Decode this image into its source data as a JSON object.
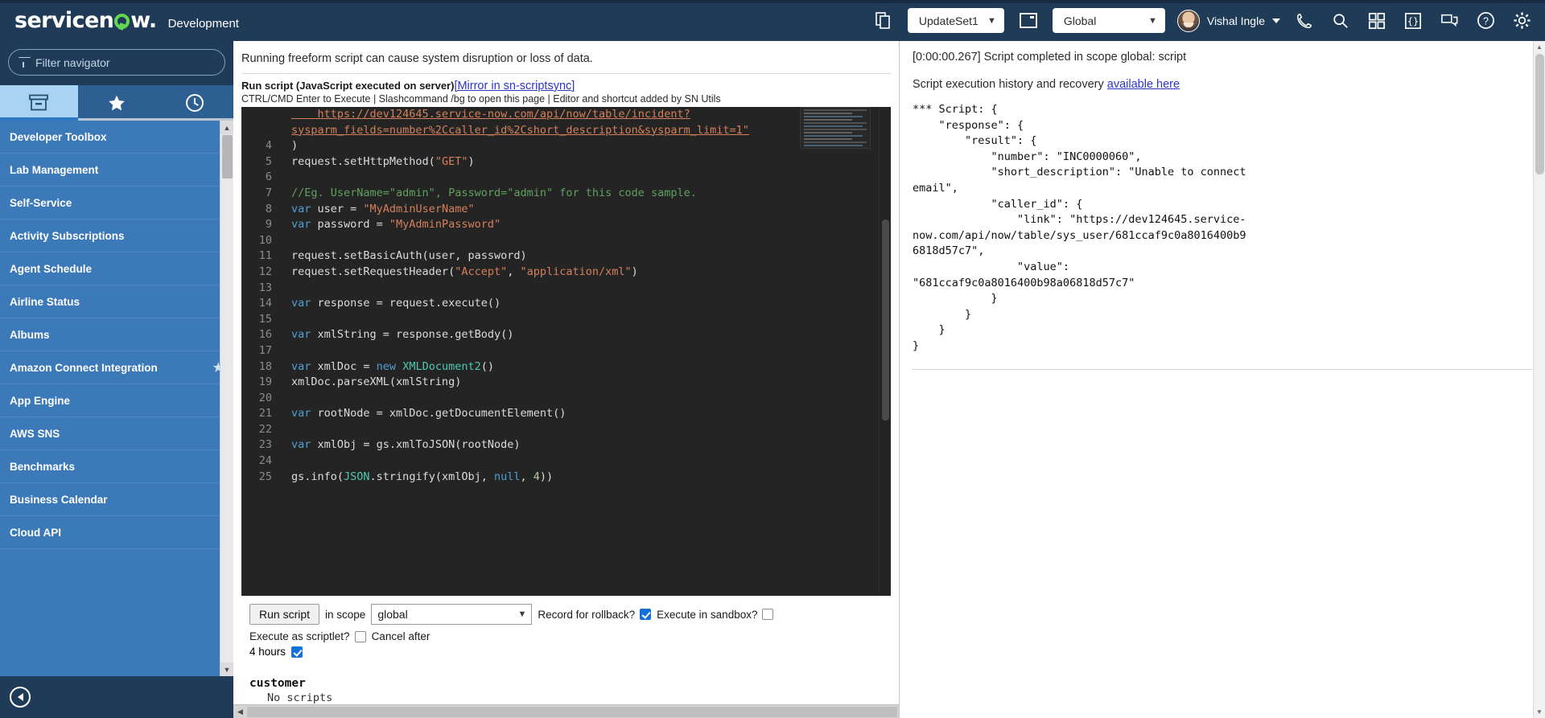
{
  "banner": {
    "logo_text": "servicenow",
    "instance_label": "Development",
    "update_set": "UpdateSet1",
    "application_scope": "Global",
    "user_name": "Vishal Ingle",
    "icons": [
      {
        "name": "copy-update-set-icon",
        "glyph": "❐"
      },
      {
        "name": "window-icon",
        "glyph": "▣"
      },
      {
        "name": "phone-icon",
        "glyph": "☎"
      },
      {
        "name": "search-icon",
        "glyph": "⌕"
      },
      {
        "name": "app-grid-icon",
        "glyph": "☷"
      },
      {
        "name": "code-braces-icon",
        "glyph": "{ }"
      },
      {
        "name": "conversation-icon",
        "glyph": "⧉"
      },
      {
        "name": "help-icon",
        "glyph": "?"
      },
      {
        "name": "gear-icon",
        "glyph": "⚙"
      }
    ]
  },
  "sidebar": {
    "filter_placeholder": "Filter navigator",
    "tabs": [
      {
        "name": "all-applications-tab",
        "icon": "archive-box-icon",
        "active": true
      },
      {
        "name": "favorites-tab",
        "icon": "star-icon",
        "active": false
      },
      {
        "name": "history-tab",
        "icon": "clock-icon",
        "active": false
      }
    ],
    "items": [
      {
        "label": "Developer Toolbox",
        "starred": false
      },
      {
        "label": "Lab Management",
        "starred": false
      },
      {
        "label": "Self-Service",
        "starred": false
      },
      {
        "label": "Activity Subscriptions",
        "starred": false
      },
      {
        "label": "Agent Schedule",
        "starred": false
      },
      {
        "label": "Airline Status",
        "starred": false
      },
      {
        "label": "Albums",
        "starred": false
      },
      {
        "label": "Amazon Connect Integration",
        "starred": true
      },
      {
        "label": "App Engine",
        "starred": false
      },
      {
        "label": "AWS SNS",
        "starred": false
      },
      {
        "label": "Benchmarks",
        "starred": false
      },
      {
        "label": "Business Calendar",
        "starred": false
      },
      {
        "label": "Cloud API",
        "starred": false
      }
    ],
    "star_glyph": "★",
    "collapse_label": "collapse-navigator"
  },
  "main": {
    "warning": "Running freeform script can cause system disruption or loss of data.",
    "script_heading": "Run script (JavaScript executed on server)",
    "mirror_link": "[Mirror in sn-scriptsync]",
    "shortcut_hint": "CTRL/CMD Enter to Execute | Slashcommand /bg to open this page | Editor and shortcut added by SN Utils",
    "code_lines": [
      {
        "num": "",
        "tokens": [
          {
            "t": "    https://dev124645.service-now.com/api/now/table/incident?",
            "c": "link-underline"
          }
        ]
      },
      {
        "num": "",
        "tokens": [
          {
            "t": "sysparm_fields=number%2Ccaller_id%2Cshort_description&sysparm_limit=1\"",
            "c": "link-underline"
          }
        ]
      },
      {
        "num": "4",
        "tokens": [
          {
            "t": ")",
            "c": "plain"
          }
        ]
      },
      {
        "num": "5",
        "tokens": [
          {
            "t": "request.setHttpMethod(",
            "c": "plain"
          },
          {
            "t": "\"GET\"",
            "c": "str"
          },
          {
            "t": ")",
            "c": "plain"
          }
        ]
      },
      {
        "num": "6",
        "tokens": [
          {
            "t": "",
            "c": "plain"
          }
        ]
      },
      {
        "num": "7",
        "tokens": [
          {
            "t": "//Eg. UserName=\"admin\", Password=\"admin\" for this code sample.",
            "c": "cmt"
          }
        ]
      },
      {
        "num": "8",
        "tokens": [
          {
            "t": "var ",
            "c": "kw"
          },
          {
            "t": "user = ",
            "c": "plain"
          },
          {
            "t": "\"MyAdminUserName\"",
            "c": "str"
          }
        ]
      },
      {
        "num": "9",
        "tokens": [
          {
            "t": "var ",
            "c": "kw"
          },
          {
            "t": "password = ",
            "c": "plain"
          },
          {
            "t": "\"MyAdminPassword\"",
            "c": "str"
          }
        ]
      },
      {
        "num": "10",
        "tokens": [
          {
            "t": "",
            "c": "plain"
          }
        ]
      },
      {
        "num": "11",
        "tokens": [
          {
            "t": "request.setBasicAuth(user, password)",
            "c": "plain"
          }
        ]
      },
      {
        "num": "12",
        "tokens": [
          {
            "t": "request.setRequestHeader(",
            "c": "plain"
          },
          {
            "t": "\"Accept\"",
            "c": "str"
          },
          {
            "t": ", ",
            "c": "plain"
          },
          {
            "t": "\"application/xml\"",
            "c": "str"
          },
          {
            "t": ")",
            "c": "plain"
          }
        ]
      },
      {
        "num": "13",
        "tokens": [
          {
            "t": "",
            "c": "plain"
          }
        ]
      },
      {
        "num": "14",
        "tokens": [
          {
            "t": "var ",
            "c": "kw"
          },
          {
            "t": "response = request.execute()",
            "c": "plain"
          }
        ]
      },
      {
        "num": "15",
        "tokens": [
          {
            "t": "",
            "c": "plain"
          }
        ]
      },
      {
        "num": "16",
        "tokens": [
          {
            "t": "var ",
            "c": "kw"
          },
          {
            "t": "xmlString = response.getBody()",
            "c": "plain"
          }
        ]
      },
      {
        "num": "17",
        "tokens": [
          {
            "t": "",
            "c": "plain"
          }
        ]
      },
      {
        "num": "18",
        "tokens": [
          {
            "t": "var ",
            "c": "kw"
          },
          {
            "t": "xmlDoc = ",
            "c": "plain"
          },
          {
            "t": "new ",
            "c": "kw"
          },
          {
            "t": "XMLDocument2",
            "c": "fn"
          },
          {
            "t": "()",
            "c": "plain"
          }
        ]
      },
      {
        "num": "19",
        "tokens": [
          {
            "t": "xmlDoc.parseXML(xmlString)",
            "c": "plain"
          }
        ]
      },
      {
        "num": "20",
        "tokens": [
          {
            "t": "",
            "c": "plain"
          }
        ]
      },
      {
        "num": "21",
        "tokens": [
          {
            "t": "var ",
            "c": "kw"
          },
          {
            "t": "rootNode = xmlDoc.getDocumentElement()",
            "c": "plain"
          }
        ]
      },
      {
        "num": "22",
        "tokens": [
          {
            "t": "",
            "c": "plain"
          }
        ]
      },
      {
        "num": "23",
        "tokens": [
          {
            "t": "var ",
            "c": "kw"
          },
          {
            "t": "xmlObj = gs.xmlToJSON(rootNode)",
            "c": "plain"
          }
        ]
      },
      {
        "num": "24",
        "tokens": [
          {
            "t": "",
            "c": "plain"
          }
        ]
      },
      {
        "num": "25",
        "tokens": [
          {
            "t": "gs.info(",
            "c": "plain"
          },
          {
            "t": "JSON",
            "c": "fn"
          },
          {
            "t": ".stringify(xmlObj, ",
            "c": "plain"
          },
          {
            "t": "null",
            "c": "kw"
          },
          {
            "t": ", ",
            "c": "plain"
          },
          {
            "t": "4",
            "c": "num"
          },
          {
            "t": "))",
            "c": "plain"
          }
        ]
      }
    ],
    "controls": {
      "run_button": "Run script",
      "in_scope_label": "in scope",
      "scope_value": "global",
      "record_rollback_label": "Record for rollback?",
      "record_rollback_checked": true,
      "execute_sandbox_label": "Execute in sandbox?",
      "execute_sandbox_checked": false,
      "execute_scriptlet_label": "Execute as scriptlet?",
      "execute_scriptlet_checked": false,
      "cancel_after_label": "Cancel after",
      "cancel_after_value": "4 hours",
      "cancel_after_checked": true
    },
    "customer_section": {
      "title": "customer",
      "body": "No scripts"
    }
  },
  "output": {
    "completion_line": "[0:00:00.267] Script completed in scope global: script",
    "history_text": "Script execution history and recovery",
    "history_link": "available here",
    "result_text": "*** Script: {\n    \"response\": {\n        \"result\": {\n            \"number\": \"INC0000060\",\n            \"short_description\": \"Unable to connect\nemail\",\n            \"caller_id\": {\n                \"link\": \"https://dev124645.service-\nnow.com/api/now/table/sys_user/681ccaf9c0a8016400b9\n6818d57c7\",\n                \"value\":\n\"681ccaf9c0a8016400b98a06818d57c7\"\n            }\n        }\n    }\n}"
  }
}
